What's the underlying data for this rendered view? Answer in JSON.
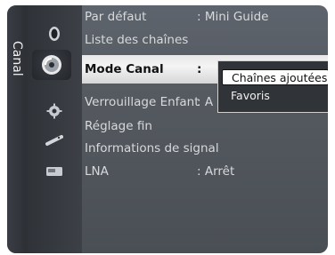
{
  "tab": {
    "label": "Canal"
  },
  "icons": [
    "satellite-dish-icon",
    "channel-globe-icon",
    "gear-icon",
    "remote-icon",
    "input-card-icon"
  ],
  "menu": [
    {
      "label": "Par défaut",
      "value": ": Mini Guide"
    },
    {
      "label": "Liste des chaînes",
      "value": ""
    },
    {
      "label": "Mode Canal",
      "value": ":"
    },
    {
      "label": "Verrouillage Enfant",
      "value": ": A"
    },
    {
      "label": "Réglage fin",
      "value": ""
    },
    {
      "label": "Informations de signal",
      "value": ""
    },
    {
      "label": "LNA",
      "value": ": Arrêt"
    }
  ],
  "popup": {
    "options": [
      "Chaînes ajoutées",
      "Favoris"
    ],
    "selected": "Chaînes ajoutées"
  },
  "colors": {
    "panel": "#54595f",
    "highlight": "#eeeeee",
    "text": "#d7d9dc",
    "selected_text": "#111111"
  }
}
